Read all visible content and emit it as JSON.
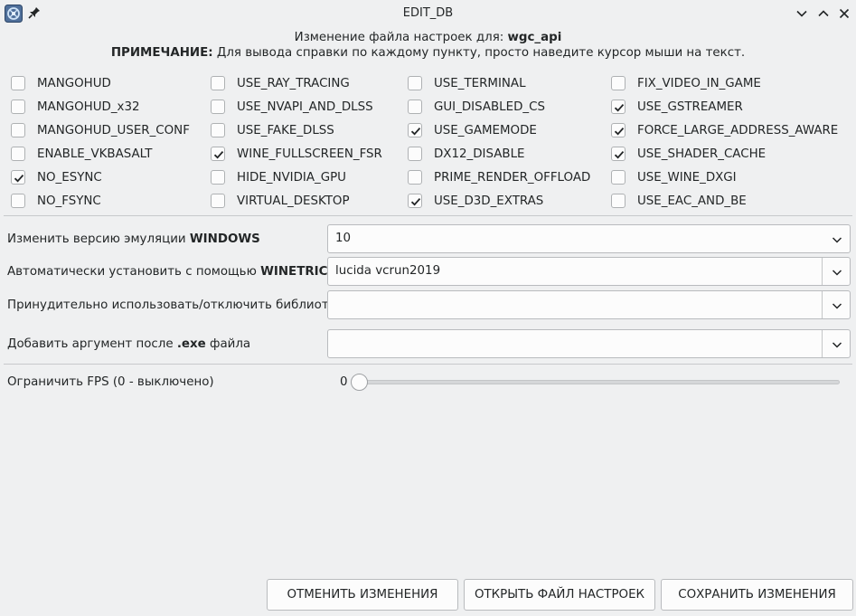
{
  "window": {
    "title": "EDIT_DB"
  },
  "header": {
    "line1_prefix": "Изменение файла настроек для: ",
    "line1_name": "wgc_api",
    "line2_bold": "ПРИМЕЧАНИЕ:",
    "line2_text": " Для вывода справки по каждому пункту, просто наведите курсор мыши на текст."
  },
  "checkboxes": [
    {
      "label": "MANGOHUD",
      "checked": false
    },
    {
      "label": "MANGOHUD_x32",
      "checked": false
    },
    {
      "label": "MANGOHUD_USER_CONF",
      "checked": false
    },
    {
      "label": "ENABLE_VKBASALT",
      "checked": false
    },
    {
      "label": "NO_ESYNC",
      "checked": true
    },
    {
      "label": "NO_FSYNC",
      "checked": false
    },
    {
      "label": "USE_RAY_TRACING",
      "checked": false
    },
    {
      "label": "USE_NVAPI_AND_DLSS",
      "checked": false
    },
    {
      "label": "USE_FAKE_DLSS",
      "checked": false
    },
    {
      "label": "WINE_FULLSCREEN_FSR",
      "checked": true
    },
    {
      "label": "HIDE_NVIDIA_GPU",
      "checked": false
    },
    {
      "label": "VIRTUAL_DESKTOP",
      "checked": false
    },
    {
      "label": "USE_TERMINAL",
      "checked": false
    },
    {
      "label": "GUI_DISABLED_CS",
      "checked": false
    },
    {
      "label": "USE_GAMEMODE",
      "checked": true
    },
    {
      "label": "DX12_DISABLE",
      "checked": false
    },
    {
      "label": "PRIME_RENDER_OFFLOAD",
      "checked": false
    },
    {
      "label": "USE_D3D_EXTRAS",
      "checked": true
    },
    {
      "label": "FIX_VIDEO_IN_GAME",
      "checked": false
    },
    {
      "label": "USE_GSTREAMER",
      "checked": true
    },
    {
      "label": "FORCE_LARGE_ADDRESS_AWARE",
      "checked": true
    },
    {
      "label": "USE_SHADER_CACHE",
      "checked": true
    },
    {
      "label": "USE_WINE_DXGI",
      "checked": false
    },
    {
      "label": "USE_EAC_AND_BE",
      "checked": false
    }
  ],
  "form": {
    "windows_label": "Изменить версию эмуляции ",
    "windows_label_bold": "WINDOWS",
    "windows_value": "10",
    "winetricks_label": "Автоматически установить с помощью ",
    "winetricks_label_bold": "WINETRICKS",
    "winetricks_value": "lucida vcrun2019",
    "dll_label": "Принудительно использовать/отключить библиотеки",
    "dll_value": "",
    "exe_label_prefix": "Добавить аргумент после ",
    "exe_label_bold": ".exe",
    "exe_label_suffix": " файла",
    "exe_value": "",
    "fps_label": "Ограничить FPS (0 - выключено)",
    "fps_value": "0"
  },
  "buttons": {
    "cancel": "ОТМЕНИТЬ ИЗМЕНЕНИЯ",
    "open": "ОТКРЫТЬ ФАЙЛ НАСТРОЕК",
    "save": "СОХРАНИТЬ ИЗМЕНЕНИЯ"
  },
  "icons": {
    "app": "app-logo-icon",
    "pin": "pin-icon",
    "minimize": "chevron-down-icon",
    "maximize": "chevron-up-icon",
    "close": "close-icon"
  },
  "colors": {
    "accent": "#1d99f3",
    "background": "#eff0f1"
  }
}
